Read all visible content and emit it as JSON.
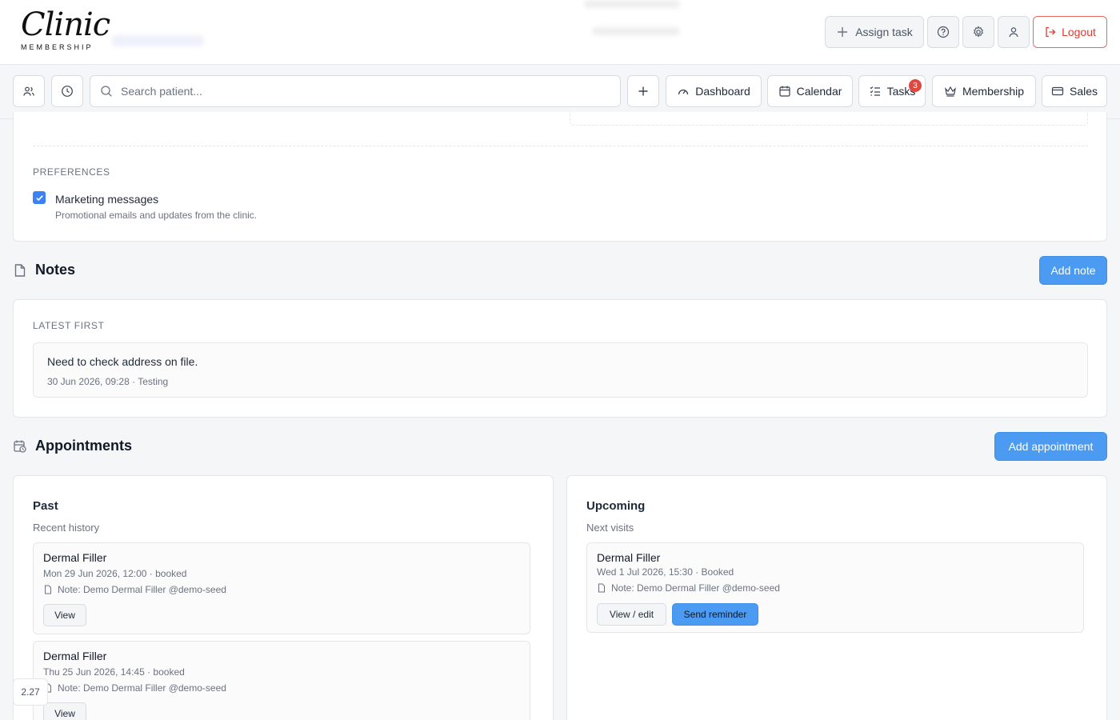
{
  "brand": {
    "logo_script": "Clinic",
    "logo_sub": "MEMBERSHIP"
  },
  "header": {
    "assign_task": "Assign task",
    "logout": "Logout"
  },
  "nav": {
    "search_placeholder": "Search patient...",
    "dashboard": "Dashboard",
    "calendar": "Calendar",
    "tasks": "Tasks",
    "tasks_badge": "3",
    "membership": "Membership",
    "sales": "Sales"
  },
  "preferences": {
    "heading": "PREFERENCES",
    "marketing_label": "Marketing messages",
    "marketing_help": "Promotional emails and updates from the clinic.",
    "marketing_checked": true
  },
  "notes": {
    "title": "Notes",
    "add_button": "Add note",
    "order_label": "LATEST FIRST",
    "items": [
      {
        "text": "Need to check address on file.",
        "meta": "30 Jun 2026, 09:28 · Testing"
      }
    ]
  },
  "appointments": {
    "title": "Appointments",
    "add_button": "Add appointment",
    "past": {
      "title": "Past",
      "subtitle": "Recent history",
      "items": [
        {
          "name": "Dermal Filler",
          "date": "Mon 29 Jun 2026, 12:00 · booked",
          "note": "Note: Demo Dermal Filler @demo-seed",
          "view": "View"
        },
        {
          "name": "Dermal Filler",
          "date": "Thu 25 Jun 2026, 14:45 · booked",
          "note": "Note: Demo Dermal Filler @demo-seed",
          "view": "View"
        }
      ]
    },
    "upcoming": {
      "title": "Upcoming",
      "subtitle": "Next visits",
      "items": [
        {
          "name": "Dermal Filler",
          "date": "Wed 1 Jul 2026, 15:30 · Booked",
          "note": "Note: Demo Dermal Filler @demo-seed",
          "view": "View / edit",
          "reminder": "Send reminder"
        }
      ]
    }
  },
  "version": "2.27"
}
